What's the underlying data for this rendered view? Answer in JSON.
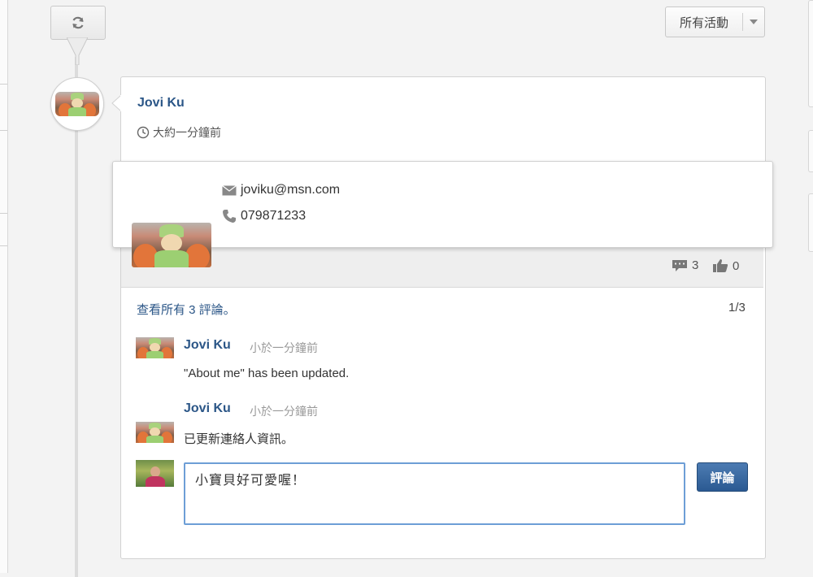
{
  "toolbar": {
    "refresh_icon": "refresh-icon",
    "activity_filter": "所有活動",
    "dropdown_icon": "caret-down-icon"
  },
  "post": {
    "author": "Jovi Ku",
    "time": "大約一分鐘前",
    "clock_icon": "clock-icon"
  },
  "contact": {
    "email": "joviku@msn.com",
    "phone": "079871233",
    "email_icon": "envelope-icon",
    "phone_icon": "phone-icon"
  },
  "stats": {
    "comments": "3",
    "likes": "0",
    "comment_icon": "comment-icon",
    "like_icon": "thumbs-up-icon"
  },
  "comments_section": {
    "view_all": "查看所有 3 評論。",
    "pager": "1/3",
    "items": [
      {
        "author": "Jovi Ku",
        "time": "小於一分鐘前",
        "text": "\"About me\" has been updated."
      },
      {
        "author": "Jovi Ku",
        "time": "小於一分鐘前",
        "text": "已更新連絡人資訊。"
      }
    ]
  },
  "new_comment": {
    "value": "小寶貝好可愛喔！",
    "submit_label": "評論"
  }
}
